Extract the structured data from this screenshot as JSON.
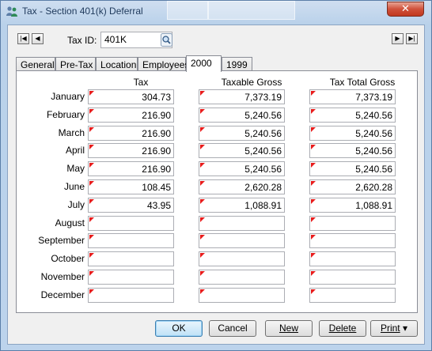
{
  "window": {
    "title": "Tax - Section 401(k) Deferral",
    "close_label": "✕"
  },
  "background_ghost_texts": [
    "",
    ""
  ],
  "taxid": {
    "label": "Tax ID:",
    "value": "401K"
  },
  "tabs": [
    "General",
    "Pre-Tax",
    "Location",
    "Employees",
    "2000",
    "1999"
  ],
  "active_tab": "2000",
  "columns": [
    "Tax",
    "Taxable Gross",
    "Tax Total Gross"
  ],
  "rows": [
    {
      "month": "January",
      "tax": "304.73",
      "taxable_gross": "7,373.19",
      "tax_total_gross": "7,373.19"
    },
    {
      "month": "February",
      "tax": "216.90",
      "taxable_gross": "5,240.56",
      "tax_total_gross": "5,240.56"
    },
    {
      "month": "March",
      "tax": "216.90",
      "taxable_gross": "5,240.56",
      "tax_total_gross": "5,240.56"
    },
    {
      "month": "April",
      "tax": "216.90",
      "taxable_gross": "5,240.56",
      "tax_total_gross": "5,240.56"
    },
    {
      "month": "May",
      "tax": "216.90",
      "taxable_gross": "5,240.56",
      "tax_total_gross": "5,240.56"
    },
    {
      "month": "June",
      "tax": "108.45",
      "taxable_gross": "2,620.28",
      "tax_total_gross": "2,620.28"
    },
    {
      "month": "July",
      "tax": "43.95",
      "taxable_gross": "1,088.91",
      "tax_total_gross": "1,088.91"
    },
    {
      "month": "August",
      "tax": "",
      "taxable_gross": "",
      "tax_total_gross": ""
    },
    {
      "month": "September",
      "tax": "",
      "taxable_gross": "",
      "tax_total_gross": ""
    },
    {
      "month": "October",
      "tax": "",
      "taxable_gross": "",
      "tax_total_gross": ""
    },
    {
      "month": "November",
      "tax": "",
      "taxable_gross": "",
      "tax_total_gross": ""
    },
    {
      "month": "December",
      "tax": "",
      "taxable_gross": "",
      "tax_total_gross": ""
    }
  ],
  "buttons": {
    "ok": "OK",
    "cancel": "Cancel",
    "new": "New",
    "delete": "Delete",
    "print": "Print"
  },
  "icons": {
    "first": "first-record-icon",
    "prev": "previous-record-icon",
    "next": "next-record-icon",
    "last": "last-record-icon",
    "search": "search-icon",
    "app": "people-icon"
  },
  "colors": {
    "marker": "#e81c1c",
    "close": "#c1381f",
    "default_button_border": "#3c7fb1"
  }
}
